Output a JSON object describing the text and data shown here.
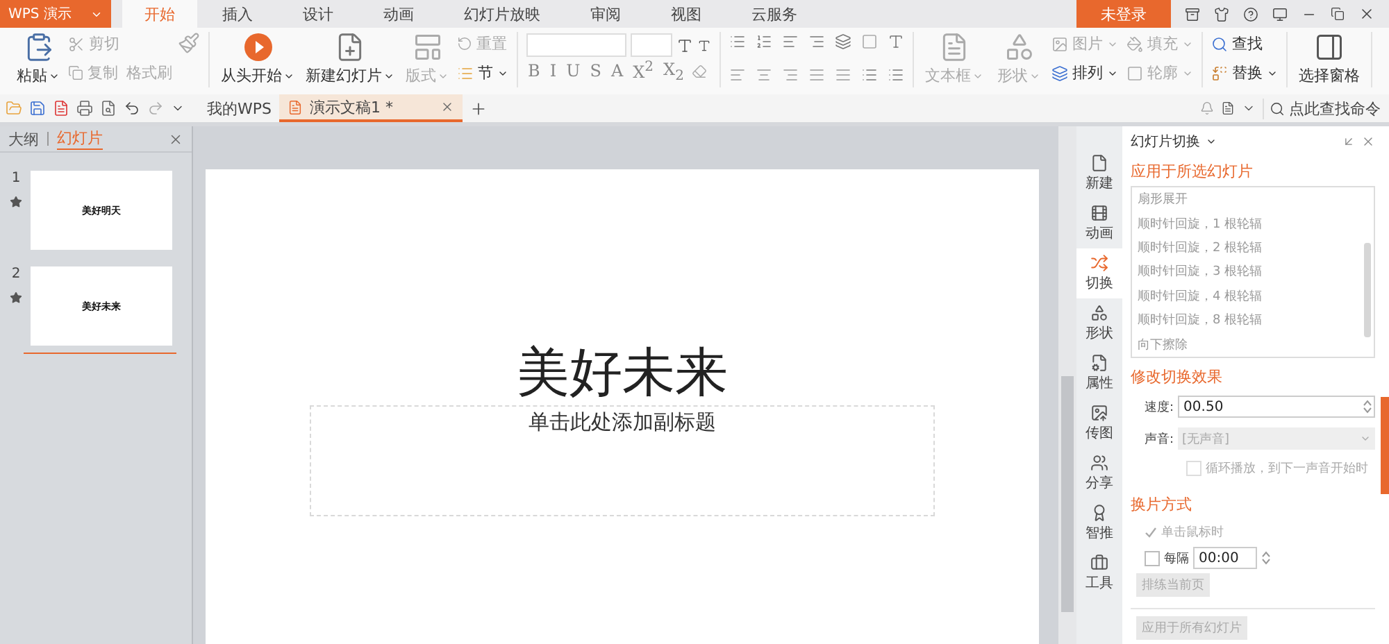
{
  "app": {
    "name": "WPS 演示"
  },
  "menu_tabs": [
    {
      "label": "开始",
      "selected": true
    },
    {
      "label": "插入",
      "selected": false
    },
    {
      "label": "设计",
      "selected": false
    },
    {
      "label": "动画",
      "selected": false
    },
    {
      "label": "幻灯片放映",
      "selected": false
    },
    {
      "label": "审阅",
      "selected": false
    },
    {
      "label": "视图",
      "selected": false
    },
    {
      "label": "云服务",
      "selected": false
    }
  ],
  "account": {
    "label": "未登录"
  },
  "ribbon": {
    "paste": {
      "label": "粘贴",
      "disabled": false
    },
    "cut": {
      "label": "剪切",
      "disabled": true
    },
    "copy": {
      "label": "复制",
      "disabled": true
    },
    "format_painter": {
      "label": "格式刷",
      "disabled": true
    },
    "play_from_start": {
      "label": "从头开始",
      "disabled": false
    },
    "new_slide": {
      "label": "新建幻灯片",
      "disabled": false
    },
    "layout": {
      "label": "版式",
      "disabled": true
    },
    "reset": {
      "label": "重置",
      "disabled": true
    },
    "section": {
      "label": "节",
      "disabled": false
    },
    "font_styles": [
      {
        "label": "B"
      },
      {
        "label": "I"
      },
      {
        "label": "U"
      },
      {
        "label": "S"
      },
      {
        "label": "A"
      },
      {
        "label": "X$^{2}$"
      },
      {
        "label": "X$_{2}$"
      }
    ],
    "text_box": {
      "label": "文本框",
      "disabled": true
    },
    "shape": {
      "label": "形状",
      "disabled": true
    },
    "picture": {
      "label": "图片",
      "disabled": true
    },
    "fill": {
      "label": "填充",
      "disabled": true
    },
    "arrange": {
      "label": "排列",
      "disabled": false
    },
    "outline": {
      "label": "轮廓",
      "disabled": true
    },
    "find": {
      "label": "查找",
      "disabled": false
    },
    "replace": {
      "label": "替换",
      "disabled": false
    },
    "selection_pane": {
      "label": "选择窗格",
      "disabled": false
    }
  },
  "doc_tabs": [
    {
      "label": "我的WPS",
      "selected": false
    },
    {
      "label": "演示文稿1 *",
      "selected": true
    }
  ],
  "command_search": {
    "label": "点此查找命令"
  },
  "panel_tabs": [
    {
      "label": "大纲",
      "selected": false
    },
    {
      "label": "幻灯片",
      "selected": true
    }
  ],
  "thumbnails": [
    {
      "number": "1",
      "title": "美好明天"
    },
    {
      "number": "2",
      "title": "美好未来"
    }
  ],
  "slide": {
    "title": "美好未来",
    "subtitle_placeholder": "单击此处添加副标题"
  },
  "side_tools": [
    {
      "label": "新建",
      "selected": false
    },
    {
      "label": "动画",
      "selected": false
    },
    {
      "label": "切换",
      "selected": true
    },
    {
      "label": "形状",
      "selected": false
    },
    {
      "label": "属性",
      "selected": false
    },
    {
      "label": "传图",
      "selected": false
    },
    {
      "label": "分享",
      "selected": false
    },
    {
      "label": "智推",
      "selected": false
    },
    {
      "label": "工具",
      "selected": false
    }
  ],
  "task_pane": {
    "title": "幻灯片切换",
    "apply_heading": "应用于所选幻灯片",
    "transitions": [
      "扇形展开",
      "顺时针回旋，1 根轮辐",
      "顺时针回旋，2 根轮辐",
      "顺时针回旋，3 根轮辐",
      "顺时针回旋，4 根轮辐",
      "顺时针回旋，8 根轮辐",
      "向下擦除"
    ],
    "effect_heading": "修改切换效果",
    "speed": {
      "label": "速度:",
      "value": "00.50"
    },
    "sound": {
      "label": "声音:",
      "value": "[无声音]",
      "disabled": true
    },
    "loop": {
      "label": "循环播放，到下一声音开始时",
      "checked": false,
      "disabled": true
    },
    "advance_heading": "换片方式",
    "on_click": {
      "label": "单击鼠标时",
      "checked": true,
      "disabled": true
    },
    "every": {
      "label": "每隔",
      "checked": false,
      "disabled": false,
      "value": "00:00"
    },
    "rehearse": {
      "label": "排练当前页",
      "disabled": true
    },
    "apply_all": {
      "label": "应用于所有幻灯片",
      "disabled": true
    }
  }
}
